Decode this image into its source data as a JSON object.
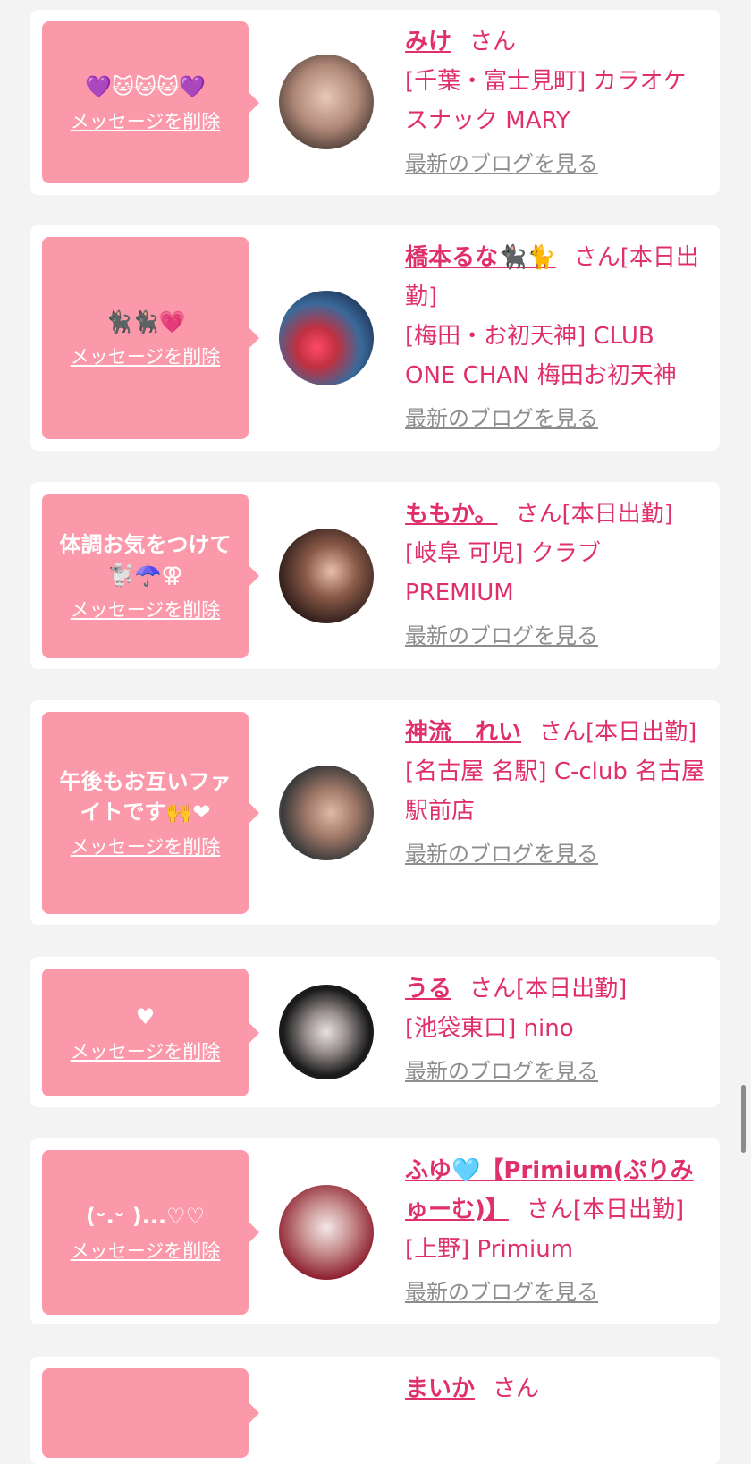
{
  "delete_label": "メッセージを削除",
  "blog_label": "最新のブログを見る",
  "san_label": "さん",
  "cards": [
    {
      "message": "💜🐱🐱🐱💜",
      "name": "みけ",
      "san": "さん",
      "shop": "[千葉・富士見町] カラオケスナック MARY"
    },
    {
      "message": "🐈‍⬛🐈‍⬛💗",
      "name": "橋本るな🐈‍⬛🐈",
      "san": "さん[本日出勤]",
      "shop": "[梅田・お初天神] CLUB ONE CHAN 梅田お初天神"
    },
    {
      "message": "体調お気をつけて🐩☂️⚢",
      "name": "ももか。",
      "san": "さん[本日出勤]",
      "shop": "[岐阜 可児] クラブ PREMIUM"
    },
    {
      "message": "午後もお互いファイトです🙌❤",
      "name": "神流　れい",
      "san": "さん[本日出勤]",
      "shop": "[名古屋 名駅] C-club 名古屋駅前店"
    },
    {
      "message": "♥",
      "name": "うる",
      "san": "さん[本日出勤]",
      "shop": "[池袋東口] nino"
    },
    {
      "message": "(ᵕ.ᵕ )...♡♡",
      "name": "ふゆ🩵【Primium(ぷりみゅーむ)】",
      "san": "さん[本日出勤]",
      "shop": "[上野] Primium"
    },
    {
      "message": "",
      "name": "まいか",
      "san": "さん",
      "shop": ""
    }
  ]
}
